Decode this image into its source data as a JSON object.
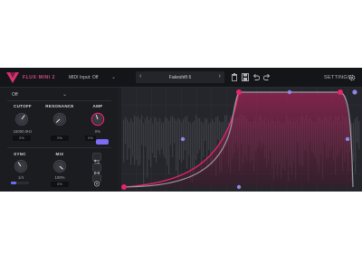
{
  "topbar": {
    "brand": "FLUX·MINI 2",
    "midi_select": "MIDI Input: Off",
    "preset_prev": "‹",
    "preset_next": "›",
    "preset_name": "Fakeshift 6",
    "settings_label": "SETTINGS",
    "icons": [
      "trash-icon",
      "save-icon",
      "undo-icon",
      "redo-icon",
      "gear-icon"
    ]
  },
  "left_panel": {
    "mode_select": "Off",
    "cutoff": {
      "label": "CUTOFF",
      "value": "16000.0Hz",
      "box": "0%",
      "level": 0.7
    },
    "resonance": {
      "label": "RESONANCE",
      "value": "0%",
      "box": "0%",
      "level": 0.0
    },
    "amp": {
      "label": "AMP",
      "value": "0%",
      "box": "0%",
      "level": 0.45
    },
    "sync": {
      "label": "SYNC",
      "value": "1/4",
      "level": 0.3
    },
    "mix": {
      "label": "MIX",
      "value": "100%",
      "box": "0%",
      "level": 1.0
    },
    "side_buttons": [
      "collapse-icon",
      "expand-icon",
      "target-icon"
    ]
  },
  "colors": {
    "accent": "#e8246f",
    "accent_dim": "#7b2750",
    "handle": "#8f86e8",
    "background": "#1d1e22"
  }
}
